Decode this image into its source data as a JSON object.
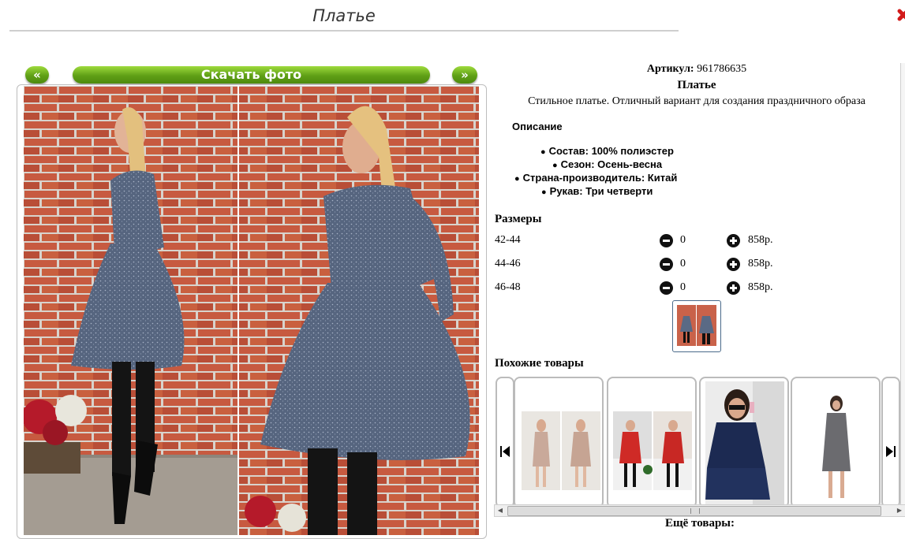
{
  "page": {
    "title": "Платье"
  },
  "gallery": {
    "prev_label": "«",
    "next_label": "»",
    "download_label": "Скачать фото"
  },
  "product": {
    "article_label": "Артикул:",
    "article_value": "961786635",
    "name": "Платье",
    "short_description": "Стильное платье. Отличный вариант для создания праздничного образа",
    "description_heading": "Описание",
    "specs": [
      "Состав: 100% полиэстер",
      "Сезон: Осень-весна",
      "Страна-производитель: Китай",
      "Рукав: Три четверти"
    ]
  },
  "sizes": {
    "heading": "Размеры",
    "rows": [
      {
        "label": "42-44",
        "quantity": "0",
        "price": "858р."
      },
      {
        "label": "44-46",
        "quantity": "0",
        "price": "858р."
      },
      {
        "label": "46-48",
        "quantity": "0",
        "price": "858р."
      }
    ]
  },
  "similar": {
    "heading": "Похожие товары"
  },
  "more": {
    "heading": "Ещё товары:"
  },
  "colors": {
    "button_green": "#5f9f16",
    "brick": "#c9533a",
    "dress": "#5a6a85"
  }
}
